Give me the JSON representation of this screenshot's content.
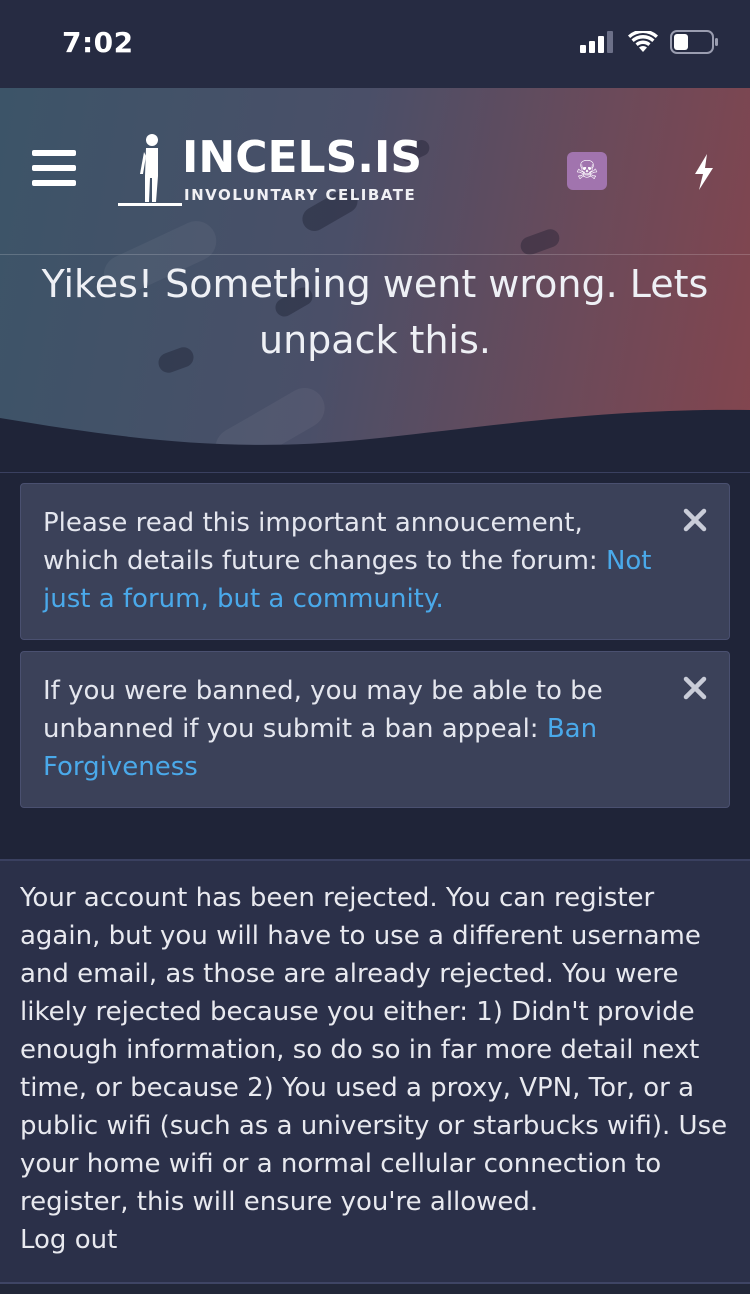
{
  "status_bar": {
    "time": "7:02",
    "icons": [
      "signal-icon",
      "wifi-icon",
      "battery-icon"
    ]
  },
  "header": {
    "logo_title": "INCELS.IS",
    "logo_subtitle": "INVOLUNTARY CELIBATE",
    "avatar_glyph": "☠",
    "icons": [
      "hamburger-menu-icon",
      "skull-avatar-icon",
      "lightning-bolt-icon"
    ]
  },
  "hero": {
    "title": "Yikes! Something went wrong. Lets unpack this."
  },
  "notices": [
    {
      "text": "Please read this important annoucement, which details future changes to the forum: ",
      "link_text": "Not just a forum, but a community."
    },
    {
      "text": "If you were banned, you may be able to be unbanned if you submit a ban appeal: ",
      "link_text": "Ban Forgiveness"
    }
  ],
  "message": {
    "text": "Your account has been rejected. You can register again, but you will have to use a different username and email, as those are already rejected. You were likely rejected because you either: 1) Didn't provide enough information, so do so in far more detail next time, or because 2) You used a proxy, VPN, Tor, or a public wifi (such as a university or starbucks wifi). Use your home wifi or a normal cellular connection to register, this will ensure you're allowed.",
    "logout_label": "Log out"
  },
  "colors": {
    "background": "#1f2438",
    "notice_bg": "#3b4159",
    "link": "#4aa9ea",
    "avatar_bg": "#a174ae"
  }
}
